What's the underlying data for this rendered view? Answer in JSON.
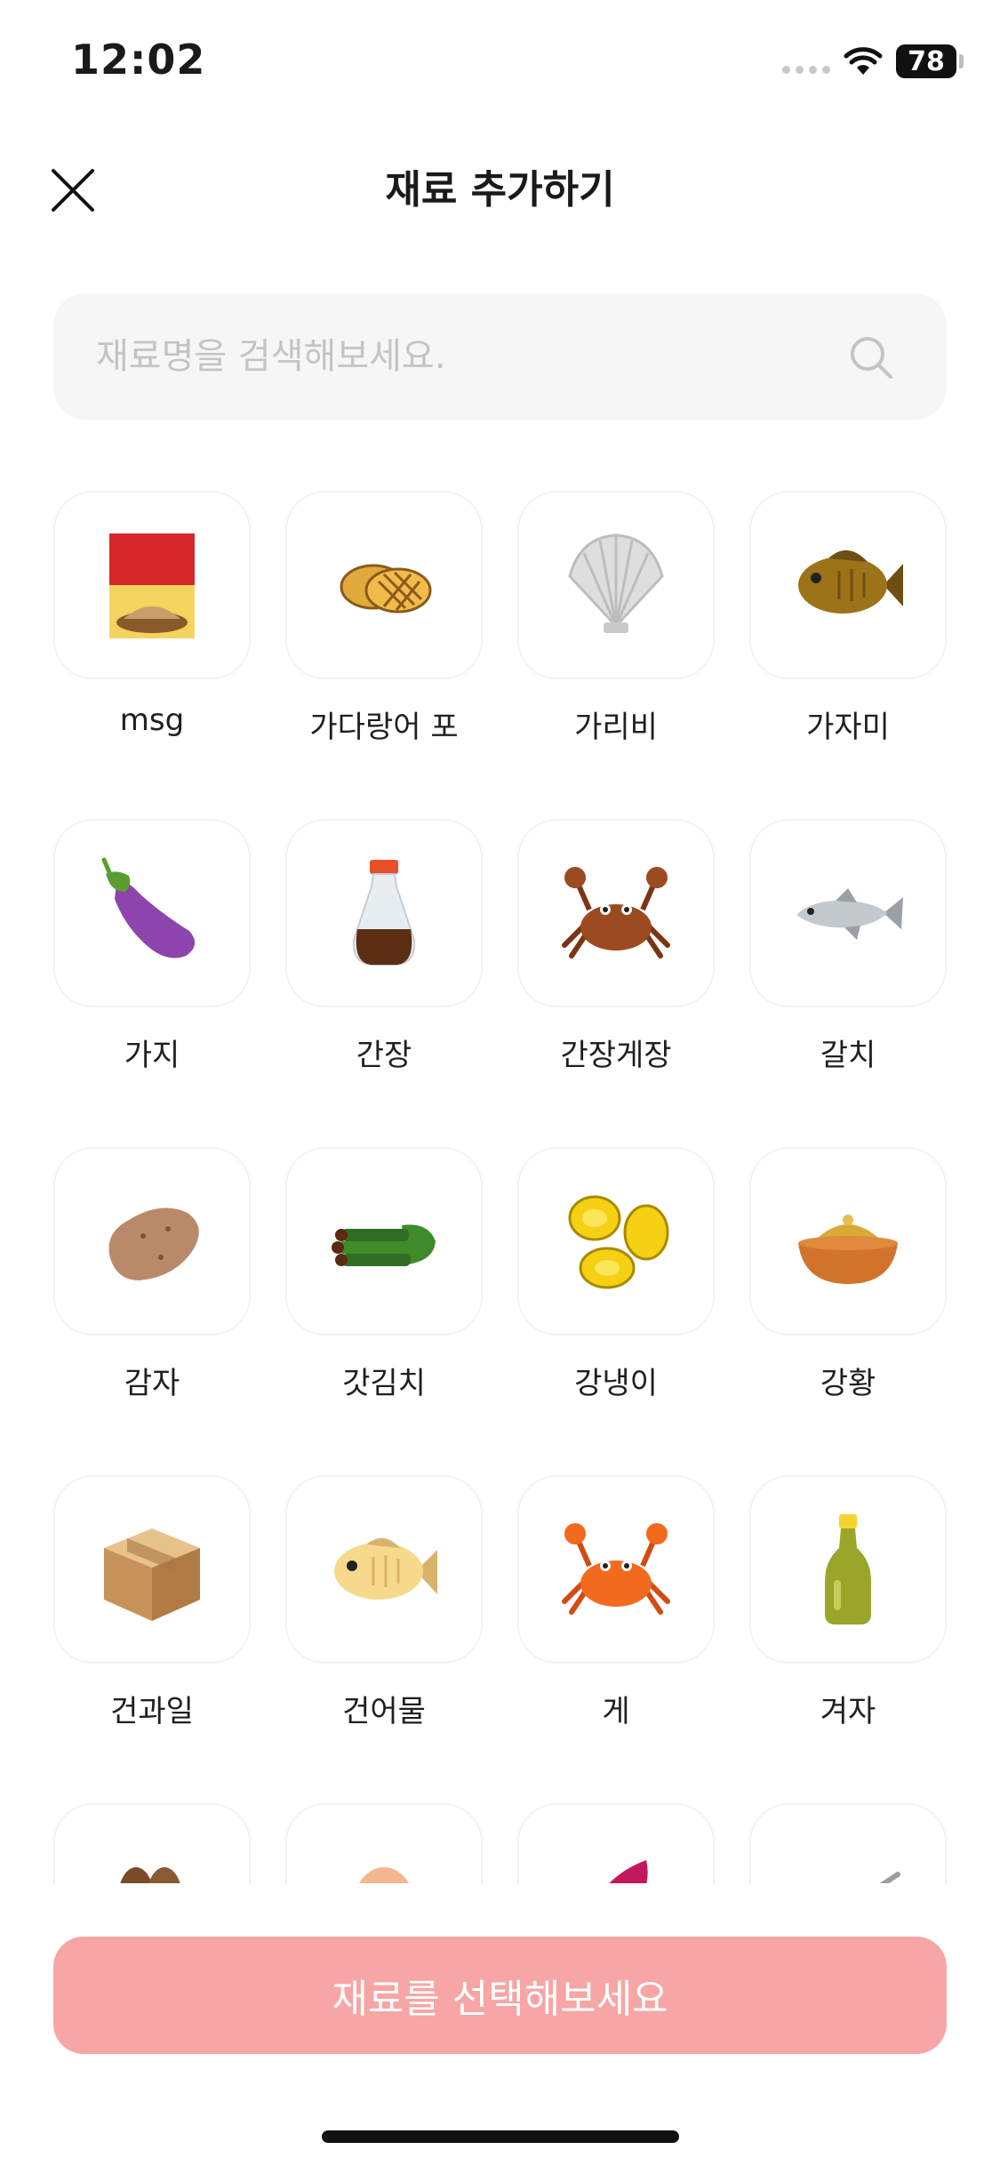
{
  "status_bar": {
    "time": "12:02",
    "battery": "78"
  },
  "header": {
    "title": "재료 추가하기",
    "close_icon": "close-icon"
  },
  "search": {
    "placeholder": "재료명을 검색해보세요.",
    "value": "",
    "icon": "search-icon"
  },
  "ingredients": [
    {
      "label": "msg",
      "icon": "msg-icon"
    },
    {
      "label": "가다랑어 포",
      "icon": "bonito-flakes-icon"
    },
    {
      "label": "가리비",
      "icon": "scallop-icon"
    },
    {
      "label": "가자미",
      "icon": "flatfish-icon"
    },
    {
      "label": "가지",
      "icon": "eggplant-icon"
    },
    {
      "label": "간장",
      "icon": "soy-sauce-icon"
    },
    {
      "label": "간장게장",
      "icon": "soy-crab-icon"
    },
    {
      "label": "갈치",
      "icon": "hairtail-icon"
    },
    {
      "label": "감자",
      "icon": "potato-icon"
    },
    {
      "label": "갓김치",
      "icon": "mustard-kimchi-icon"
    },
    {
      "label": "강냉이",
      "icon": "puffed-corn-icon"
    },
    {
      "label": "강황",
      "icon": "turmeric-icon"
    },
    {
      "label": "건과일",
      "icon": "box-icon"
    },
    {
      "label": "건어물",
      "icon": "dried-fish-icon"
    },
    {
      "label": "게",
      "icon": "crab-icon"
    },
    {
      "label": "겨자",
      "icon": "mustard-bottle-icon"
    },
    {
      "label": "",
      "icon": "nut-icon"
    },
    {
      "label": "",
      "icon": "egg-icon"
    },
    {
      "label": "",
      "icon": "sweet-potato-icon"
    },
    {
      "label": "",
      "icon": "bowl-icon"
    }
  ],
  "cta": {
    "label": "재료를 선택해보세요"
  },
  "colors": {
    "cta_bg": "#f7a5a5",
    "search_bg": "#f6f6f6",
    "tile_border": "#f2f2f2"
  }
}
